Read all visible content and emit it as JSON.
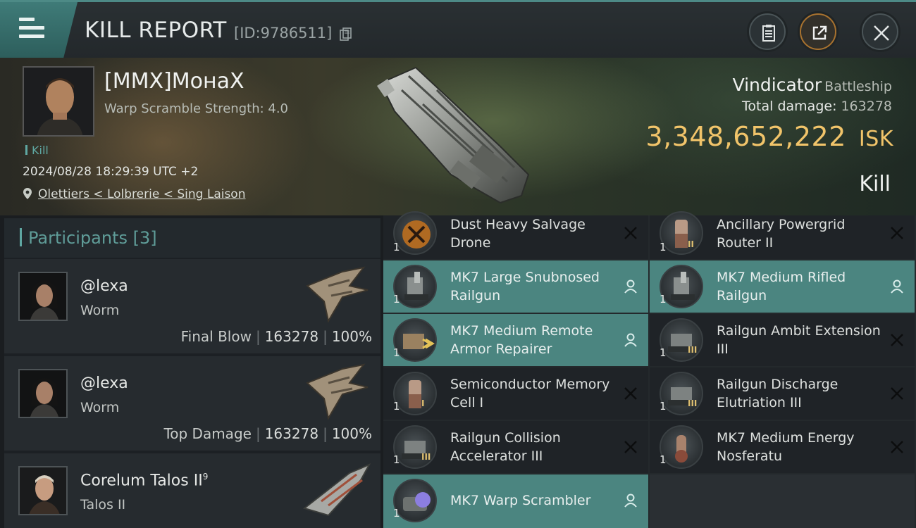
{
  "header": {
    "title": "KILL REPORT",
    "id_text": "[ID:9786511]"
  },
  "victim": {
    "name": "[MMX]MонаX",
    "scramble": "Warp Scramble Strength: 4.0",
    "tag": "Kill",
    "datetime": "2024/08/28 18:29:39 UTC +2",
    "location": "Olettiers < Lolbrerie < Sing Laison",
    "ship": "Vindicator",
    "ship_class": "Battleship",
    "total_damage_label": "Total damage:",
    "total_damage": "163278",
    "isk_value": "3,348,652,222",
    "isk_unit": "ISK",
    "result": "Kill"
  },
  "participants": {
    "label": "Participants",
    "count": "[3]",
    "rows": [
      {
        "name": "@lexa",
        "ship": "Worm",
        "role": "Final Blow",
        "damage": "163278",
        "percent": "100%"
      },
      {
        "name": "@lexa",
        "ship": "Worm",
        "role": "Top Damage",
        "damage": "163278",
        "percent": "100%"
      },
      {
        "name": "Corelum Talos II",
        "name_sup": "9",
        "ship": "Talos II"
      }
    ]
  },
  "modules": [
    {
      "label": "Dust Heavy Salvage Drone",
      "qty": "1",
      "state": "destroyed"
    },
    {
      "label": "Ancillary Powergrid Router II",
      "qty": "1",
      "state": "destroyed",
      "tier": "II"
    },
    {
      "label": "MK7 Large Snubnosed Railgun",
      "qty": "1",
      "state": "dropped"
    },
    {
      "label": "MK7 Medium Rifled Railgun",
      "qty": "1",
      "state": "dropped"
    },
    {
      "label": "MK7 Medium Remote Armor Repairer",
      "qty": "1",
      "state": "dropped"
    },
    {
      "label": "Railgun Ambit Extension III",
      "qty": "1",
      "state": "destroyed",
      "tier": "III"
    },
    {
      "label": "Semiconductor Memory Cell I",
      "qty": "1",
      "state": "destroyed",
      "tier": "I"
    },
    {
      "label": "Railgun Discharge Elutriation III",
      "qty": "1",
      "state": "destroyed",
      "tier": "III"
    },
    {
      "label": "Railgun Collision Accelerator III",
      "qty": "1",
      "state": "destroyed",
      "tier": "III"
    },
    {
      "label": "MK7 Medium Energy Nosferatu",
      "qty": "1",
      "state": "destroyed"
    },
    {
      "label": "MK7 Warp Scrambler",
      "qty": "1",
      "state": "dropped"
    }
  ],
  "colors": {
    "accent_teal": "#4b8580",
    "isk_gold": "#f1c46a",
    "background": "#1a1d20"
  },
  "icons": {
    "menu": "hamburger-menu-icon",
    "copy": "copy-icon",
    "clipboard": "clipboard-icon",
    "share": "share-icon",
    "close": "close-icon",
    "location": "map-pin-icon",
    "destroyed": "x-mark-icon",
    "dropped": "person-icon"
  }
}
